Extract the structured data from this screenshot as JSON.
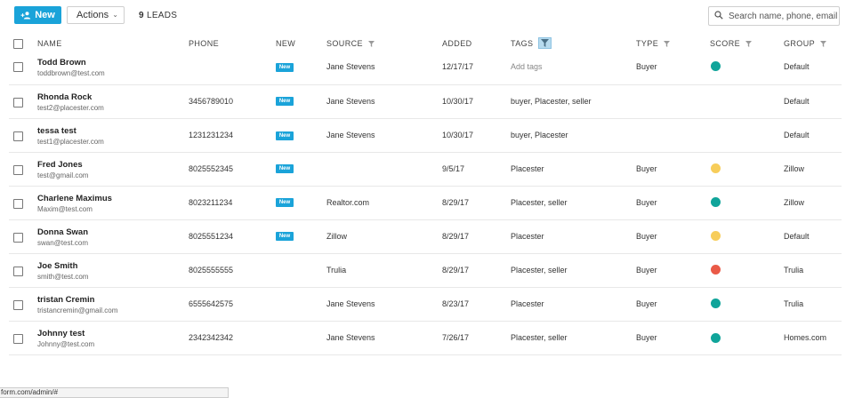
{
  "toolbar": {
    "new_label": "New",
    "actions_label": "Actions",
    "leads_count": "9",
    "leads_label": "LEADS",
    "search_placeholder": "Search name, phone, email"
  },
  "columns": {
    "name": "NAME",
    "phone": "PHONE",
    "new": "NEW",
    "source": "SOURCE",
    "added": "ADDED",
    "tags": "TAGS",
    "type": "TYPE",
    "score": "SCORE",
    "group": "GROUP"
  },
  "colors": {
    "accent": "#1aa3d9",
    "score_teal": "#10a49a",
    "score_yellow": "#f7cd5a",
    "score_red": "#ea5a47"
  },
  "rows": [
    {
      "name": "Todd Brown",
      "email": "toddbrown@test.com",
      "phone": "",
      "new": "New",
      "source": "Jane Stevens",
      "added": "12/17/17",
      "tags": "Add tags",
      "type": "Buyer",
      "score": "teal",
      "group": "Default"
    },
    {
      "name": "Rhonda Rock",
      "email": "test2@placester.com",
      "phone": "3456789010",
      "new": "New",
      "source": "Jane Stevens",
      "added": "10/30/17",
      "tags": "buyer, Placester, seller",
      "type": "",
      "score": "",
      "group": "Default"
    },
    {
      "name": "tessa test",
      "email": "test1@placester.com",
      "phone": "1231231234",
      "new": "New",
      "source": "Jane Stevens",
      "added": "10/30/17",
      "tags": "buyer, Placester",
      "type": "",
      "score": "",
      "group": "Default"
    },
    {
      "name": "Fred Jones",
      "email": "test@gmail.com",
      "phone": "8025552345",
      "new": "New",
      "source": "",
      "added": "9/5/17",
      "tags": "Placester",
      "type": "Buyer",
      "score": "yellow",
      "group": "Zillow"
    },
    {
      "name": "Charlene Maximus",
      "email": "Maxim@test.com",
      "phone": "8023211234",
      "new": "New",
      "source": "Realtor.com",
      "added": "8/29/17",
      "tags": "Placester, seller",
      "type": "Buyer",
      "score": "teal",
      "group": "Zillow"
    },
    {
      "name": "Donna Swan",
      "email": "swan@test.com",
      "phone": "8025551234",
      "new": "New",
      "source": "Zillow",
      "added": "8/29/17",
      "tags": "Placester",
      "type": "Buyer",
      "score": "yellow",
      "group": "Default"
    },
    {
      "name": "Joe Smith",
      "email": "smith@test.com",
      "phone": "8025555555",
      "new": "",
      "source": "Trulia",
      "added": "8/29/17",
      "tags": "Placester, seller",
      "type": "Buyer",
      "score": "red",
      "group": "Trulia"
    },
    {
      "name": "tristan Cremin",
      "email": "tristancremin@gmail.com",
      "phone": "6555642575",
      "new": "",
      "source": "Jane Stevens",
      "added": "8/23/17",
      "tags": "Placester",
      "type": "Buyer",
      "score": "teal",
      "group": "Trulia"
    },
    {
      "name": "Johnny test",
      "email": "Johnny@test.com",
      "phone": "2342342342",
      "new": "",
      "source": "Jane Stevens",
      "added": "7/26/17",
      "tags": "Placester, seller",
      "type": "Buyer",
      "score": "teal",
      "group": "Homes.com"
    }
  ],
  "status_bar": {
    "url": "form.com/admin/#"
  }
}
